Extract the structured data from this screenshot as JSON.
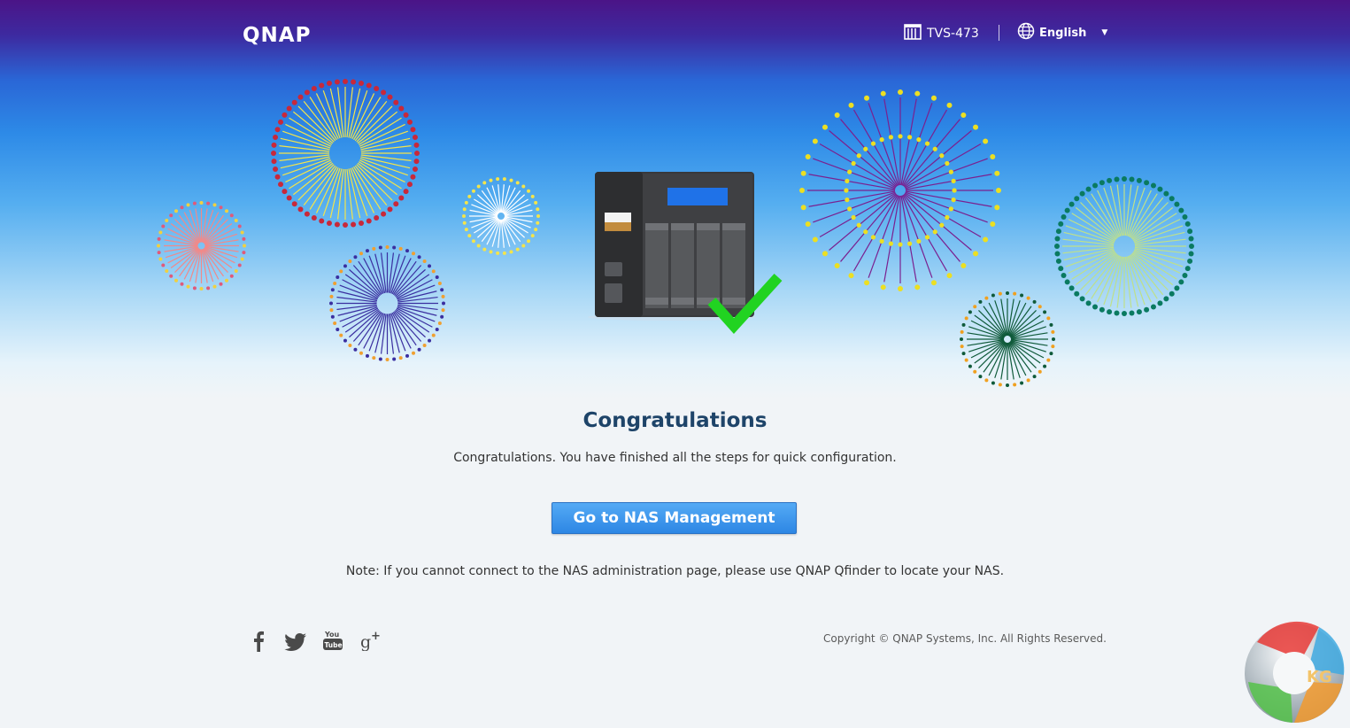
{
  "header": {
    "logo_text": "QNAP",
    "model": "TVS-473",
    "language": "English"
  },
  "main": {
    "title": "Congratulations",
    "subtitle": "Congratulations. You have finished all the steps for quick configuration.",
    "button_label": "Go to NAS Management",
    "note": "Note: If you cannot connect to the NAS administration page, please use QNAP Qfinder to locate your NAS."
  },
  "footer": {
    "social": [
      "facebook-icon",
      "twitter-icon",
      "youtube-icon",
      "google-plus-icon"
    ],
    "youtube_text_top": "You",
    "youtube_text_bottom": "Tube",
    "copyright": "Copyright © QNAP Systems, Inc. All Rights Reserved."
  },
  "watermark": {
    "text": "KG"
  },
  "colors": {
    "header_top": "#4b1487",
    "sky_blue": "#2d8ae7",
    "title": "#1e4469",
    "button": "#2d86e4",
    "check": "#21d321"
  }
}
